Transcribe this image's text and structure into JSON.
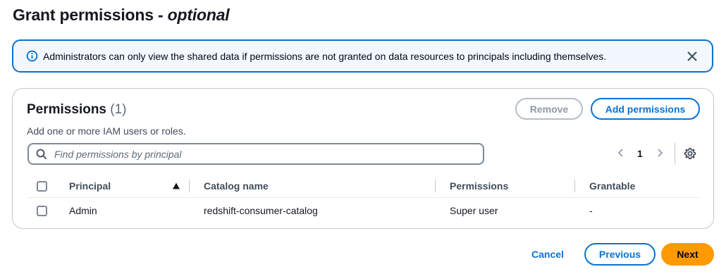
{
  "page": {
    "title": "Grant permissions - ",
    "title_optional": "optional"
  },
  "alert": {
    "message": "Administrators can only view the shared data if permissions are not granted on data resources to principals including themselves.",
    "icon": "info-icon",
    "close_icon": "close-icon",
    "color": "#0972d3"
  },
  "permissions": {
    "title": "Permissions",
    "count": "(1)",
    "description": "Add one or more IAM users or roles.",
    "remove_label": "Remove",
    "add_label": "Add permissions",
    "search_placeholder": "Find permissions by principal",
    "page_number": "1",
    "columns": [
      "Principal",
      "Catalog name",
      "Permissions",
      "Grantable"
    ],
    "rows": [
      {
        "principal": "Admin",
        "catalog_name": "redshift-consumer-catalog",
        "permissions": "Super user",
        "grantable": "-"
      }
    ]
  },
  "footer": {
    "cancel_label": "Cancel",
    "previous_label": "Previous",
    "next_label": "Next",
    "primary_color": "#ff9900"
  }
}
